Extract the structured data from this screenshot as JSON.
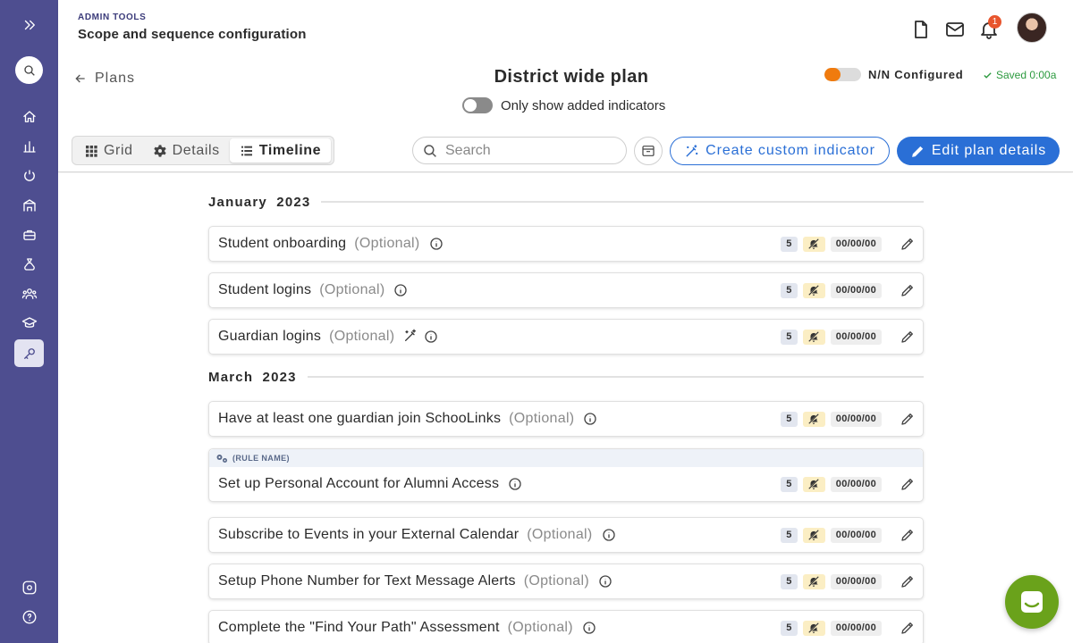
{
  "header": {
    "eyebrow": "ADMIN TOOLS",
    "app_title": "Scope and sequence configuration",
    "notification_count": "1",
    "back_label": "Plans",
    "plan_title": "District wide plan",
    "toggle_label": "Only show added indicators",
    "configured_label": "N/N Configured",
    "configured_progress": 0.45,
    "saved_label": "Saved 0:00a"
  },
  "toolbar": {
    "tabs": [
      {
        "label": "Grid",
        "icon": "grid-icon"
      },
      {
        "label": "Details",
        "icon": "gear-icon"
      },
      {
        "label": "Timeline",
        "icon": "list-icon",
        "active": true
      }
    ],
    "search_placeholder": "Search",
    "create_label": "Create custom indicator",
    "edit_label": "Edit plan details"
  },
  "months": [
    {
      "label": "January 2023"
    },
    {
      "label": "March 2023"
    }
  ],
  "indicators": [
    {
      "name": "Student onboarding",
      "optional": "(Optional)",
      "count": "5",
      "date": "00/00/00"
    },
    {
      "name": "Student logins",
      "optional": "(Optional)",
      "count": "5",
      "date": "00/00/00"
    },
    {
      "name": "Guardian logins",
      "optional": "(Optional)",
      "count": "5",
      "date": "00/00/00",
      "custom": true
    },
    {
      "name": "Have at least one guardian join SchooLinks",
      "optional": "(Optional)",
      "count": "5",
      "date": "00/00/00"
    },
    {
      "name": "Set up Personal Account for Alumni Access",
      "optional": "",
      "count": "5",
      "date": "00/00/00",
      "rule_label": "(RULE NAME)"
    },
    {
      "name": "Subscribe to Events in your External Calendar",
      "optional": "(Optional)",
      "count": "5",
      "date": "00/00/00"
    },
    {
      "name": "Setup Phone Number for Text Message Alerts",
      "optional": "(Optional)",
      "count": "5",
      "date": "00/00/00"
    },
    {
      "name": "Complete the \"Find Your Path\" Assessment",
      "optional": "(Optional)",
      "count": "5",
      "date": "00/00/00"
    }
  ],
  "colors": {
    "rail": "#4e4e90",
    "accent": "#2a6fd6",
    "progress": "#f07b0e",
    "saved": "#2c9a3f",
    "help_fab": "#6aa21b"
  }
}
